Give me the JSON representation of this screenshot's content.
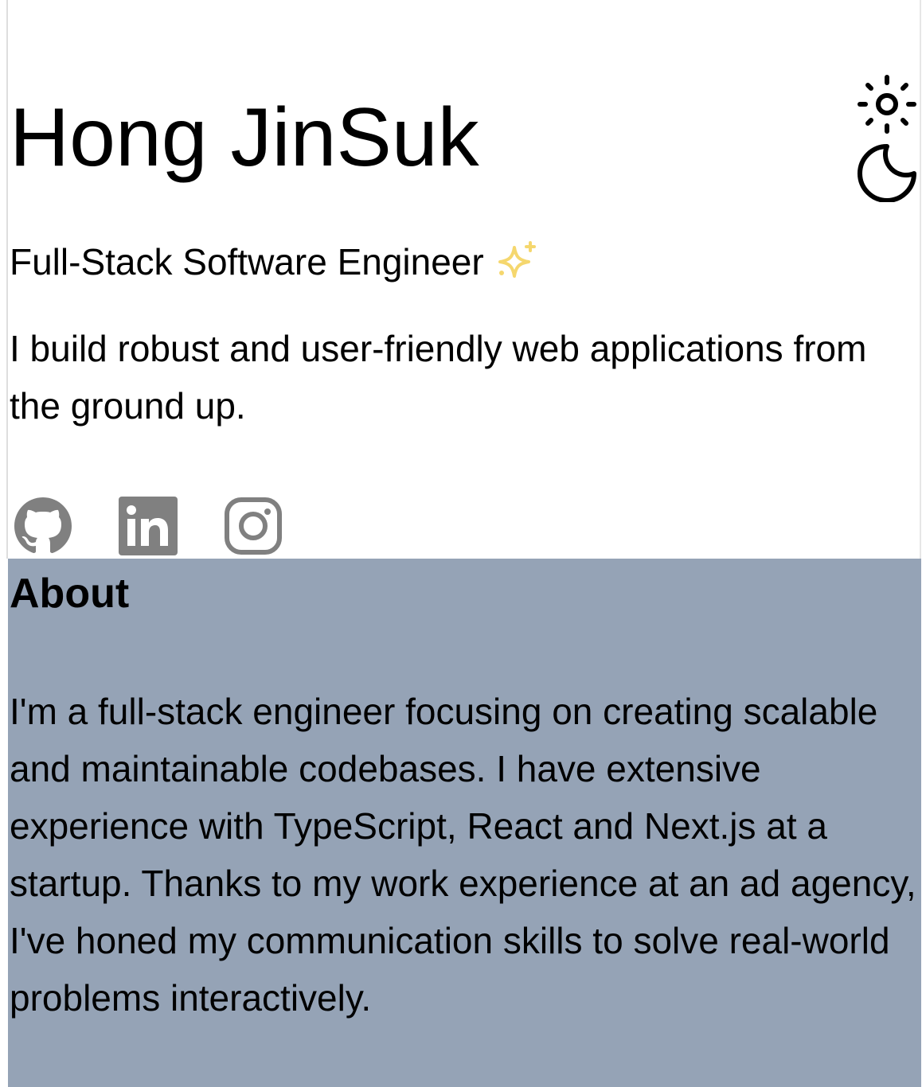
{
  "hero": {
    "name": "Hong JinSuk",
    "role": "Full-Stack Software Engineer",
    "role_icon": "sparkles-icon",
    "intro": "I build robust and user-friendly web applications from the ground up."
  },
  "theme_toggle": {
    "icons": [
      "sun-icon",
      "moon-icon"
    ]
  },
  "socials": [
    {
      "name": "GitHub",
      "icon": "github-icon"
    },
    {
      "name": "LinkedIn",
      "icon": "linkedin-icon"
    },
    {
      "name": "Instagram",
      "icon": "instagram-icon"
    }
  ],
  "about": {
    "heading": "About",
    "body": "I'm a full-stack engineer focusing on creating scalable and maintainable codebases. I have extensive experience with TypeScript, React and Next.js at a startup. Thanks to my work experience at an ad agency, I've honed my communication skills to solve real-world problems interactively."
  },
  "colors": {
    "about_background": "#95a3b6",
    "social_icon": "#808080",
    "sparkle": "#f5d76e",
    "text": "#000000"
  }
}
